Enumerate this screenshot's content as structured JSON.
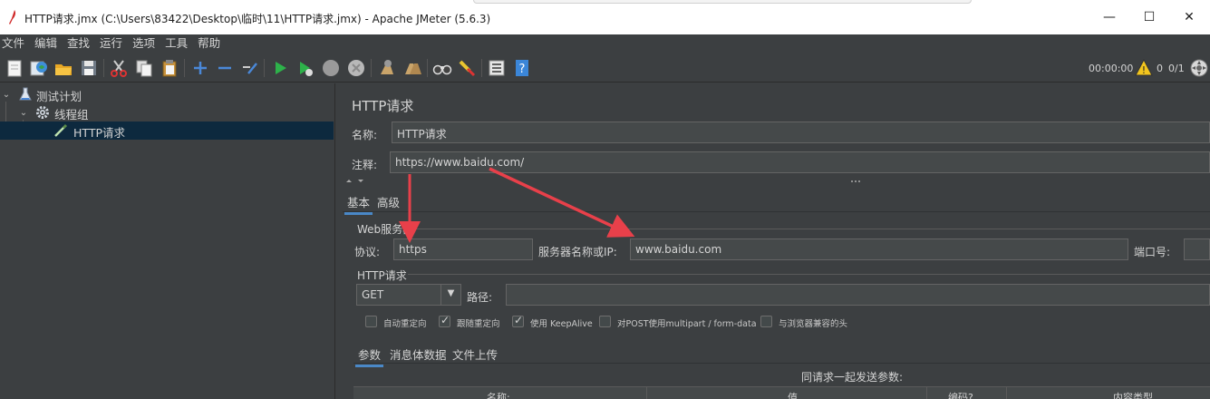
{
  "window": {
    "title": "HTTP请求.jmx (C:\\Users\\83422\\Desktop\\临时\\11\\HTTP请求.jmx) - Apache JMeter (5.6.3)",
    "minimize": "—",
    "maximize": "☐",
    "close": "✕"
  },
  "menu": [
    "文件",
    "编辑",
    "查找",
    "运行",
    "选项",
    "工具",
    "帮助"
  ],
  "toolbar": {
    "icons": [
      "new-icon",
      "templates-icon",
      "open-icon",
      "save-icon",
      "cut-icon",
      "copy-icon",
      "paste-icon",
      "expand-icon",
      "collapse-icon",
      "toggle-icon",
      "start-icon",
      "start-no-pause-icon",
      "stop-icon",
      "shutdown-icon",
      "clear-icon",
      "clear-all-icon",
      "search-icon",
      "reset-search-icon",
      "function-helper-icon",
      "help-icon"
    ],
    "elapsed_time": "00:00:00",
    "warning_count": "0",
    "threads": "0/1"
  },
  "tree": {
    "items": [
      {
        "label": "测试计划",
        "icon": "test-plan-icon"
      },
      {
        "label": "线程组",
        "icon": "gear-icon"
      },
      {
        "label": "HTTP请求",
        "icon": "pipette-icon"
      }
    ]
  },
  "panel": {
    "title": "HTTP请求",
    "name_label": "名称:",
    "name_value": "HTTP请求",
    "comment_label": "注释:",
    "comment_value": "https://www.baidu.com/",
    "tabs": [
      "基本",
      "高级"
    ],
    "web_server": {
      "group_label": "Web服务器",
      "protocol_label": "协议:",
      "protocol_value": "https",
      "server_label": "服务器名称或IP:",
      "server_value": "www.baidu.com",
      "port_label": "端口号:",
      "port_value": ""
    },
    "http_request": {
      "group_label": "HTTP请求",
      "method": "GET",
      "path_label": "路径:",
      "path_value": ""
    },
    "options": [
      {
        "label": "自动重定向",
        "checked": false
      },
      {
        "label": "跟随重定向",
        "checked": true
      },
      {
        "label": "使用 KeepAlive",
        "checked": true
      },
      {
        "label": "对POST使用multipart / form-data",
        "checked": false
      },
      {
        "label": "与浏览器兼容的头",
        "checked": false
      }
    ],
    "sub_tabs": [
      "参数",
      "消息体数据",
      "文件上传"
    ],
    "params_caption": "同请求一起发送参数:",
    "table_headers": [
      "名称:",
      "值",
      "编码?",
      "内容类型"
    ]
  },
  "colors": {
    "background": "#3c3f41",
    "field": "#45494a",
    "selection": "#0d293e",
    "tab_underline": "#4a88c7",
    "annotation_arrow": "#e8404a"
  }
}
